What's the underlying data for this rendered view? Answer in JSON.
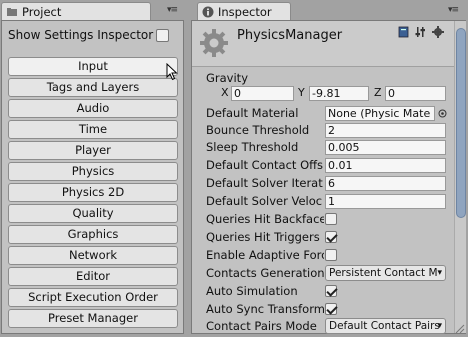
{
  "project_tab": {
    "title": "Project"
  },
  "inspector_tab": {
    "title": "Inspector"
  },
  "left_panel": {
    "show_settings_label": "Show Settings Inspector",
    "buttons": [
      "Input",
      "Tags and Layers",
      "Audio",
      "Time",
      "Player",
      "Physics",
      "Physics 2D",
      "Quality",
      "Graphics",
      "Network",
      "Editor",
      "Script Execution Order",
      "Preset Manager"
    ]
  },
  "inspector": {
    "title": "PhysicsManager",
    "gravity": {
      "label": "Gravity",
      "x_label": "X",
      "x": "0",
      "y_label": "Y",
      "y": "-9.81",
      "z_label": "Z",
      "z": "0"
    },
    "props": {
      "default_material": {
        "label": "Default Material",
        "value": "None (Physic Mate"
      },
      "bounce_threshold": {
        "label": "Bounce Threshold",
        "value": "2"
      },
      "sleep_threshold": {
        "label": "Sleep Threshold",
        "value": "0.005"
      },
      "default_contact_offset": {
        "label": "Default Contact Offs",
        "value": "0.01"
      },
      "default_solver_iterations": {
        "label": "Default Solver Iterat",
        "value": "6"
      },
      "default_solver_velocity": {
        "label": "Default Solver Veloc",
        "value": "1"
      },
      "queries_hit_backfaces": {
        "label": "Queries Hit Backface",
        "checked": false
      },
      "queries_hit_triggers": {
        "label": "Queries Hit Triggers",
        "checked": true
      },
      "enable_adaptive_force": {
        "label": "Enable Adaptive Forc",
        "checked": false
      },
      "contacts_generation": {
        "label": "Contacts Generation",
        "value": "Persistent Contact M"
      },
      "auto_simulation": {
        "label": "Auto Simulation",
        "checked": true
      },
      "auto_sync_transforms": {
        "label": "Auto Sync Transform",
        "checked": true
      },
      "contact_pairs_mode": {
        "label": "Contact Pairs Mode",
        "value": "Default Contact Pairs"
      }
    }
  },
  "colors": {
    "panel": "#c2c2c2",
    "scroll_thumb": "#8fa4bf",
    "header": "#cbcbcb"
  }
}
